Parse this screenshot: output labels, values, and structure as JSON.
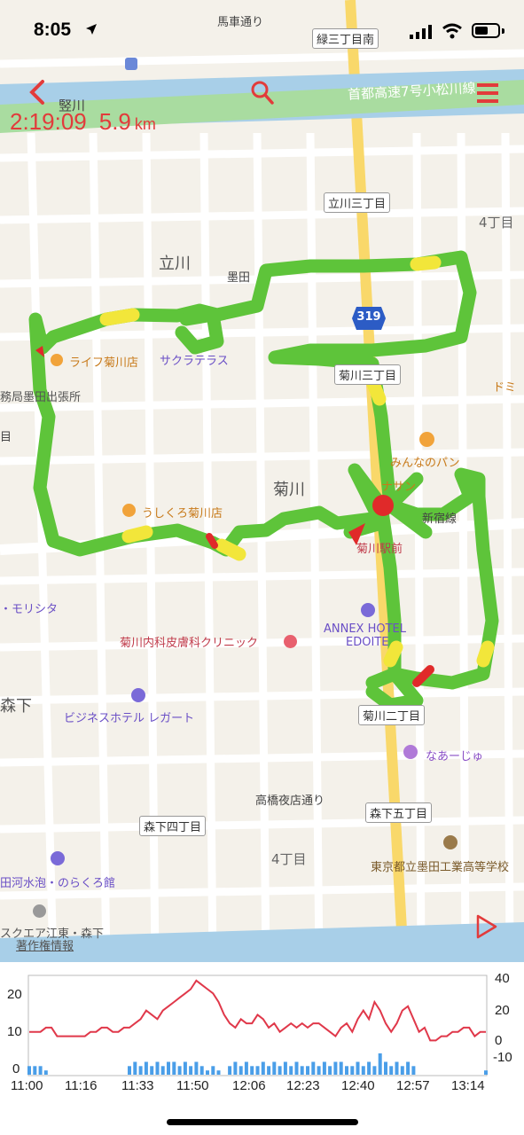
{
  "status_bar": {
    "time": "8:05"
  },
  "header": {
    "elapsed": "2:19:09",
    "distance": "5.9",
    "distance_unit": "km"
  },
  "colors": {
    "accent": "#e23b3b",
    "track": "#5ec43a",
    "track_slow": "#f2e63a",
    "track_stop": "#e02a2a",
    "speed_line": "#e0384a",
    "elevation_bars": "#4a9ee8",
    "expressway": "#a9dca0",
    "main_road": "#f9d86a"
  },
  "icons": {
    "back": "chevron-left-icon",
    "search": "search-icon",
    "menu": "menu-icon",
    "play": "play-icon",
    "location": "location-arrow-icon"
  },
  "map": {
    "roads": [
      {
        "label": "馬車通り"
      },
      {
        "label": "首都高速7号小松川線"
      },
      {
        "label": "高橋夜店通り"
      }
    ],
    "blocks": [
      "緑三丁目南",
      "立川三丁目",
      "菊川三丁目",
      "菊川二丁目",
      "森下五丁目",
      "森下四丁目"
    ],
    "route_shield": "319",
    "places": [
      {
        "label": "竪川"
      },
      {
        "label": "立川"
      },
      {
        "label": "菊川"
      },
      {
        "label": "森下"
      },
      {
        "label": "4丁目"
      },
      {
        "label": "4丁目"
      },
      {
        "label": "墨田"
      },
      {
        "label": "ライフ菊川店"
      },
      {
        "label": "サクラテラス"
      },
      {
        "label": "務局墨田出張所"
      },
      {
        "label": "うしくろ菊川店"
      },
      {
        "label": "みんなのパン"
      },
      {
        "label": "ナサン"
      },
      {
        "label": "新宿線"
      },
      {
        "label": "菊川駅前"
      },
      {
        "label": "・モリシタ"
      },
      {
        "label": "ANNEX HOTEL"
      },
      {
        "label": "EDOITE"
      },
      {
        "label": "菊川内科皮膚科クリニック"
      },
      {
        "label": "ビジネスホテル レガート"
      },
      {
        "label": "なあーじゅ"
      },
      {
        "label": "東京都立墨田工業高等学校"
      },
      {
        "label": "田河水泡・のらくろ館"
      },
      {
        "label": "スクエア江東・森下"
      },
      {
        "label": "著作権情報"
      },
      {
        "label": "ドミ"
      },
      {
        "label": "目"
      }
    ]
  },
  "chart_data": {
    "type": "line",
    "x_ticks": [
      "11:00",
      "11:16",
      "11:33",
      "11:50",
      "12:06",
      "12:23",
      "12:40",
      "12:57",
      "13:14"
    ],
    "left_axis": {
      "ticks": [
        "20",
        "10",
        "0"
      ],
      "range": [
        0,
        23
      ]
    },
    "right_axis": {
      "ticks": [
        "40",
        "20",
        "0",
        "-10"
      ],
      "range": [
        -12,
        42
      ]
    },
    "series": [
      {
        "color": "#e0384a",
        "values": [
          10,
          10,
          10,
          11,
          11,
          9,
          9,
          9,
          9,
          9,
          9,
          10,
          10,
          11,
          11,
          10,
          10,
          11,
          11,
          12,
          13,
          15,
          14,
          13,
          15,
          16,
          17,
          18,
          19,
          20,
          22,
          21,
          20,
          19,
          17,
          14,
          12,
          11,
          13,
          12,
          12,
          14,
          13,
          11,
          12,
          10,
          11,
          12,
          11,
          12,
          11,
          12,
          12,
          11,
          10,
          9,
          11,
          12,
          10,
          13,
          15,
          13,
          17,
          15,
          12,
          10,
          12,
          15,
          16,
          13,
          10,
          11,
          8,
          8,
          9,
          9,
          10,
          10,
          11,
          11,
          9,
          10,
          10
        ]
      },
      {
        "color": "#4a9ee8",
        "values": [
          2,
          2,
          2,
          1,
          0,
          0,
          0,
          0,
          0,
          0,
          0,
          0,
          0,
          0,
          0,
          0,
          0,
          0,
          2,
          3,
          2,
          3,
          2,
          3,
          2,
          3,
          3,
          2,
          3,
          2,
          3,
          2,
          1,
          2,
          1,
          0,
          2,
          3,
          2,
          3,
          2,
          2,
          3,
          2,
          3,
          2,
          3,
          2,
          3,
          2,
          2,
          3,
          2,
          3,
          2,
          3,
          3,
          2,
          2,
          3,
          2,
          3,
          2,
          5,
          3,
          2,
          3,
          2,
          3,
          2,
          0,
          0,
          0,
          0,
          0,
          0,
          0,
          0,
          0,
          0,
          0,
          0,
          1
        ]
      }
    ],
    "ylim": [
      0,
      23
    ]
  }
}
